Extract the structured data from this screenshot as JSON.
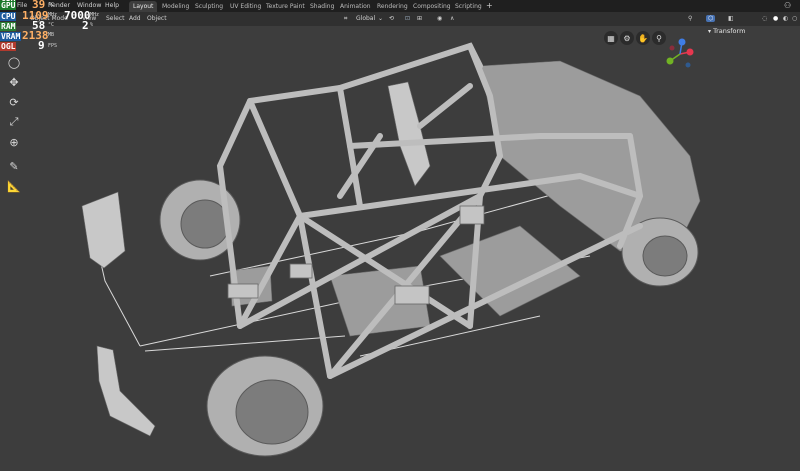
{
  "menus": [
    "File",
    "Render",
    "Window",
    "Help"
  ],
  "workspace_tabs": [
    "Layout",
    "Modeling",
    "Sculpting",
    "UV Editing",
    "Texture Paint",
    "Shading",
    "Animation",
    "Rendering",
    "Compositing",
    "Scripting"
  ],
  "active_tab_index": 0,
  "add_tab_icon": "+",
  "header": {
    "mode_label": "Object Mode",
    "view_menu": "View",
    "select_menu": "Select",
    "add_menu": "Add",
    "object_menu": "Object",
    "transform_orientation": "Global"
  },
  "stats_overlay": {
    "rows": [
      {
        "label": "GPU",
        "value": "39",
        "unit": "°C",
        "value2": "",
        "unit2": ""
      },
      {
        "label": "CPU",
        "value": "1109",
        "unit": "MHz",
        "value2": "7000",
        "unit2": "MHz"
      },
      {
        "label": "RAM",
        "value": "58",
        "unit": "°C",
        "value2": "2",
        "unit2": "%"
      },
      {
        "label": "VRAM",
        "value": "2138",
        "unit": "MB",
        "value2": "",
        "unit2": ""
      },
      {
        "label": "OGL",
        "value": "9",
        "unit": "FPS",
        "value2": "",
        "unit2": ""
      }
    ]
  },
  "sidebar_panel": {
    "title": "Transform"
  },
  "colors": {
    "axis_x": "#e6374f",
    "axis_y": "#71b324",
    "axis_z": "#3f7de6",
    "viewport_bg": "#3d3d3d",
    "model": "#b9b9b9"
  }
}
